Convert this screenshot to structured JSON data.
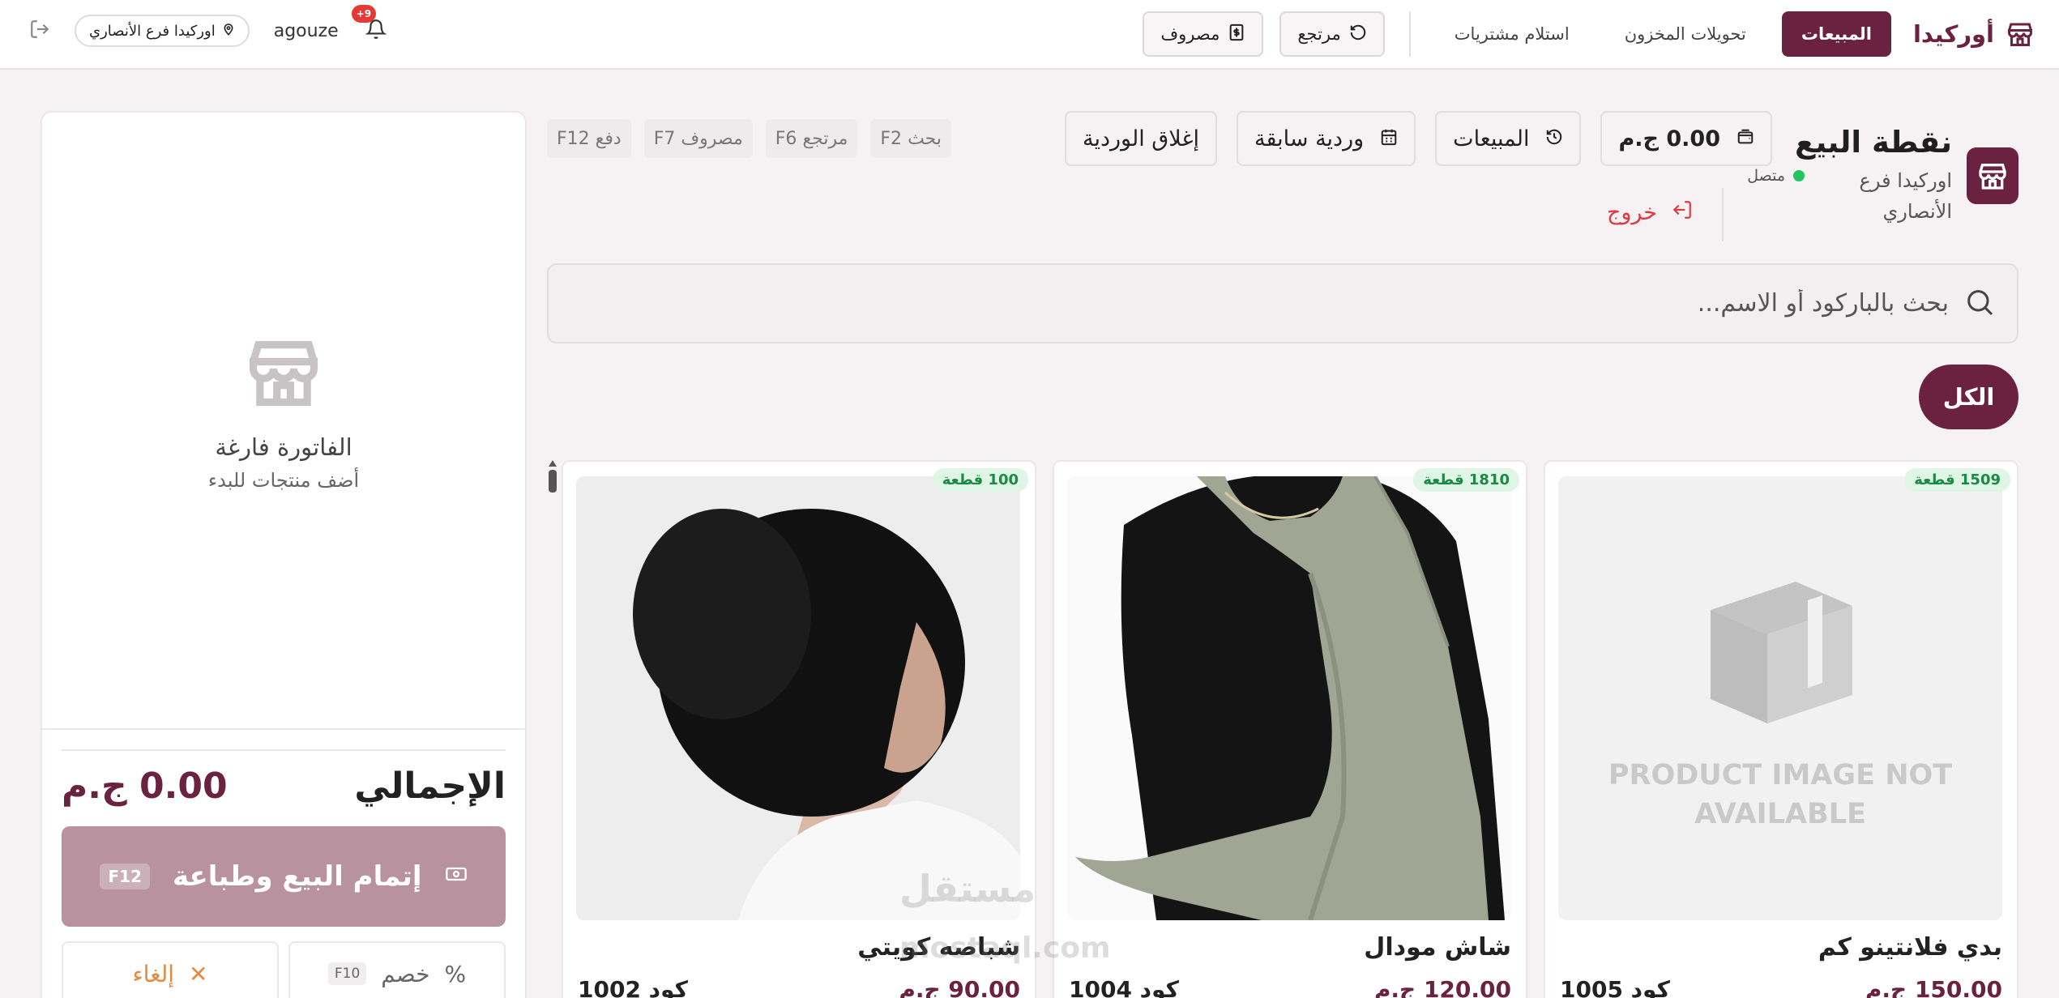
{
  "brand": {
    "name": "أوركيدا"
  },
  "nav": {
    "tabs": [
      "المبيعات",
      "تحويلات المخزون",
      "استلام مشتريات"
    ],
    "return_btn": "مرتجع",
    "expense_btn": "مصروف"
  },
  "user": {
    "notif_badge": "+9",
    "username": "agouze",
    "branch": "اوركيدا فرع الأنصاري"
  },
  "pos": {
    "title": "نقطة البيع",
    "branch": "اوركيدا فرع الأنصاري",
    "status": "متصل",
    "logout": "خروج",
    "wallet": "0.00 ج.م",
    "sales_btn": "المبيعات",
    "prev_shift_btn": "وردية سابقة",
    "close_shift_btn": "إغلاق الوردية",
    "shortcuts": [
      "F2 بحث",
      "F6 مرتجع",
      "F7 مصروف",
      "F12 دفع"
    ]
  },
  "search": {
    "placeholder": "بحث بالباركود أو الاسم..."
  },
  "categories": {
    "all": "الكل"
  },
  "products": [
    {
      "stock": "100 قطعة",
      "name": "شباصه كويتي",
      "price": "90.00 ج.م",
      "code": "كود 1002"
    },
    {
      "stock": "1810 قطعة",
      "name": "شاش مودال",
      "price": "120.00 ج.م",
      "code": "كود 1004"
    },
    {
      "stock": "1509 قطعة",
      "name": "بدي فلانتينو كم",
      "price": "150.00 ج.م",
      "code": "كود 1005",
      "placeholder": "PRODUCT IMAGE NOT AVAILABLE"
    }
  ],
  "cart": {
    "empty_title": "الفاتورة فارغة",
    "empty_sub": "أضف منتجات للبدء",
    "total_label": "الإجمالي",
    "total_value": "0.00 ج.م",
    "checkout": "إتمام البيع وطباعة",
    "checkout_key": "F12",
    "discount": "خصم",
    "discount_key": "F10",
    "cancel": "إلغاء"
  },
  "watermark": {
    "line1": "مستقل",
    "line2": "mostaql.com"
  },
  "colors": {
    "primary": "#6a2240",
    "checkout": "#b8929f",
    "danger": "#e0393e",
    "online": "#22c55e"
  }
}
